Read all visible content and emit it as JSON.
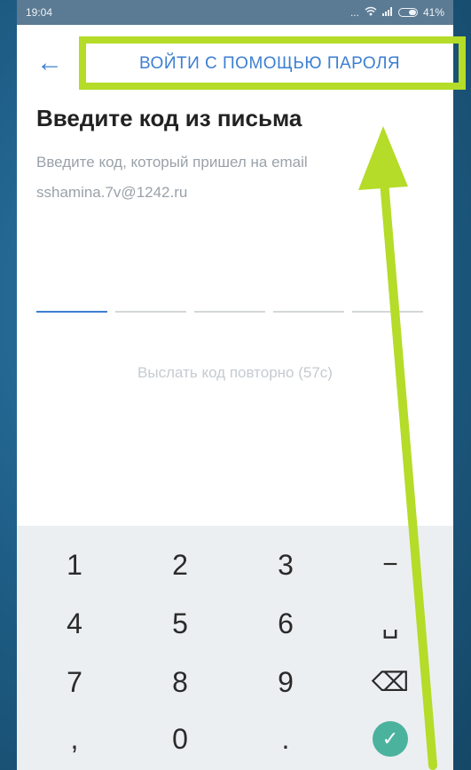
{
  "status": {
    "time": "19:04",
    "signal": "...",
    "battery": "41%"
  },
  "header": {
    "back_icon": "←",
    "password_link": "ВОЙТИ С ПОМОЩЬЮ ПАРОЛЯ"
  },
  "content": {
    "title": "Введите код из письма",
    "subtitle_line1": "Введите код, который пришел на email",
    "email": "sshamina.7v@1242.ru",
    "resend": "Выслать код повторно (57с)"
  },
  "keyboard": {
    "keys": [
      "1",
      "2",
      "3",
      "−",
      "4",
      "5",
      "6",
      "␣",
      "7",
      "8",
      "9",
      "⌫",
      ",",
      "0",
      "."
    ],
    "done": "✓"
  },
  "annotation": {
    "highlight_color": "#b4dc28"
  }
}
